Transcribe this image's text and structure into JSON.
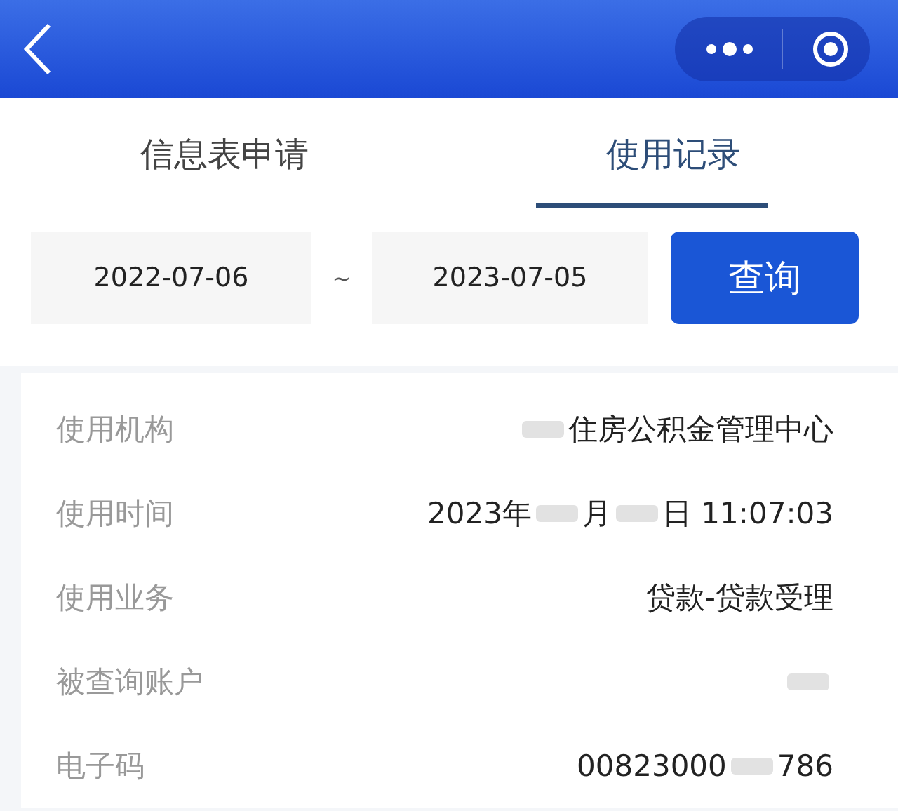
{
  "tabs": [
    {
      "label": "信息表申请",
      "selected": false
    },
    {
      "label": "使用记录",
      "selected": true
    }
  ],
  "date_range": {
    "start": "2022-07-06",
    "separator": "~",
    "end": "2023-07-05"
  },
  "query_button": "查询",
  "record": [
    {
      "label": "使用机构",
      "parts": [
        {
          "kind": "redacted"
        },
        {
          "kind": "text",
          "text": "住房公积金管理中心"
        }
      ]
    },
    {
      "label": "使用时间",
      "parts": [
        {
          "kind": "text",
          "text": "2023年"
        },
        {
          "kind": "redacted"
        },
        {
          "kind": "text",
          "text": "月"
        },
        {
          "kind": "redacted"
        },
        {
          "kind": "text",
          "text": "日 11:07:03"
        }
      ]
    },
    {
      "label": "使用业务",
      "parts": [
        {
          "kind": "text",
          "text": "贷款-贷款受理"
        }
      ]
    },
    {
      "label": "被查询账户",
      "parts": [
        {
          "kind": "redacted"
        }
      ]
    },
    {
      "label": "电子码",
      "parts": [
        {
          "kind": "text",
          "text": "00823000"
        },
        {
          "kind": "redacted"
        },
        {
          "kind": "text",
          "text": "786"
        }
      ]
    }
  ]
}
